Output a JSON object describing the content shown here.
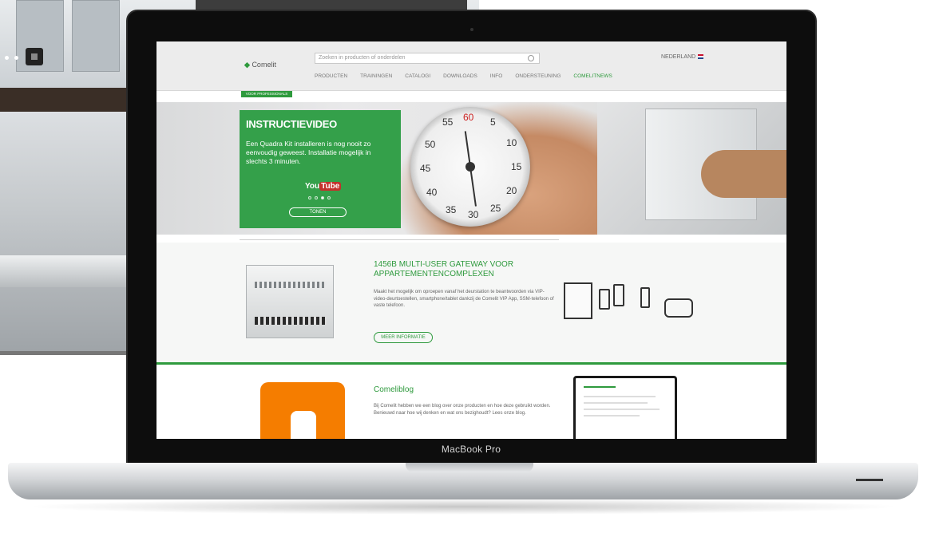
{
  "device": {
    "brand_label": "MacBook Pro"
  },
  "site": {
    "logo": "Comelit",
    "search_placeholder": "Zoeken in producten of onderdelen",
    "language": "NEDERLAND",
    "nav": [
      {
        "label": "PRODUCTEN",
        "active": false
      },
      {
        "label": "TRAININGEN",
        "active": false
      },
      {
        "label": "CATALOGI",
        "active": false
      },
      {
        "label": "DOWNLOADS",
        "active": false
      },
      {
        "label": "INFO",
        "active": false
      },
      {
        "label": "ONDERSTEUNING",
        "active": false
      },
      {
        "label": "COMELITNEWS",
        "active": true
      }
    ],
    "pro_tab": "VOOR PROFESSIONALS"
  },
  "hero": {
    "title": "INSTRUCTIEVIDEO",
    "text": "Een Quadra Kit installeren is nog nooit zo eenvoudig geweest. Installatie mogelijk in slechts 3 minuten.",
    "youtube_you": "You",
    "youtube_tube": "Tube",
    "button": "TONEN",
    "stopwatch": {
      "n55": "55",
      "n60": "60",
      "n5": "5",
      "n50": "50",
      "n10": "10",
      "n45": "45",
      "n15": "15",
      "n40": "40",
      "n20": "20",
      "n35": "35",
      "n30": "30",
      "n25": "25"
    }
  },
  "product": {
    "title": "1456B MULTI-USER GATEWAY VOOR APPARTEMENTENCOMPLEXEN",
    "text": "Maakt het mogelijk om oproepen vanaf het deurstation te beantwoorden via VIP-video-deurtoestellen, smartphone/tablet dankzij de Comelit VIP App, SSM-telefoon of vaste telefoon.",
    "button": "MEER INFORMATIE"
  },
  "blog": {
    "title": "Comeliblog",
    "text_1": "Bij Comelit hebben we een blog over onze producten en hoe deze gebruikt worden.",
    "text_2": "Benieuwd naar hoe wij denken en wat ons bezighoudt? Lees onze blog."
  },
  "colors": {
    "accent": "#2e9a3d",
    "blogger": "#f57d00",
    "youtube": "#c4302b"
  }
}
